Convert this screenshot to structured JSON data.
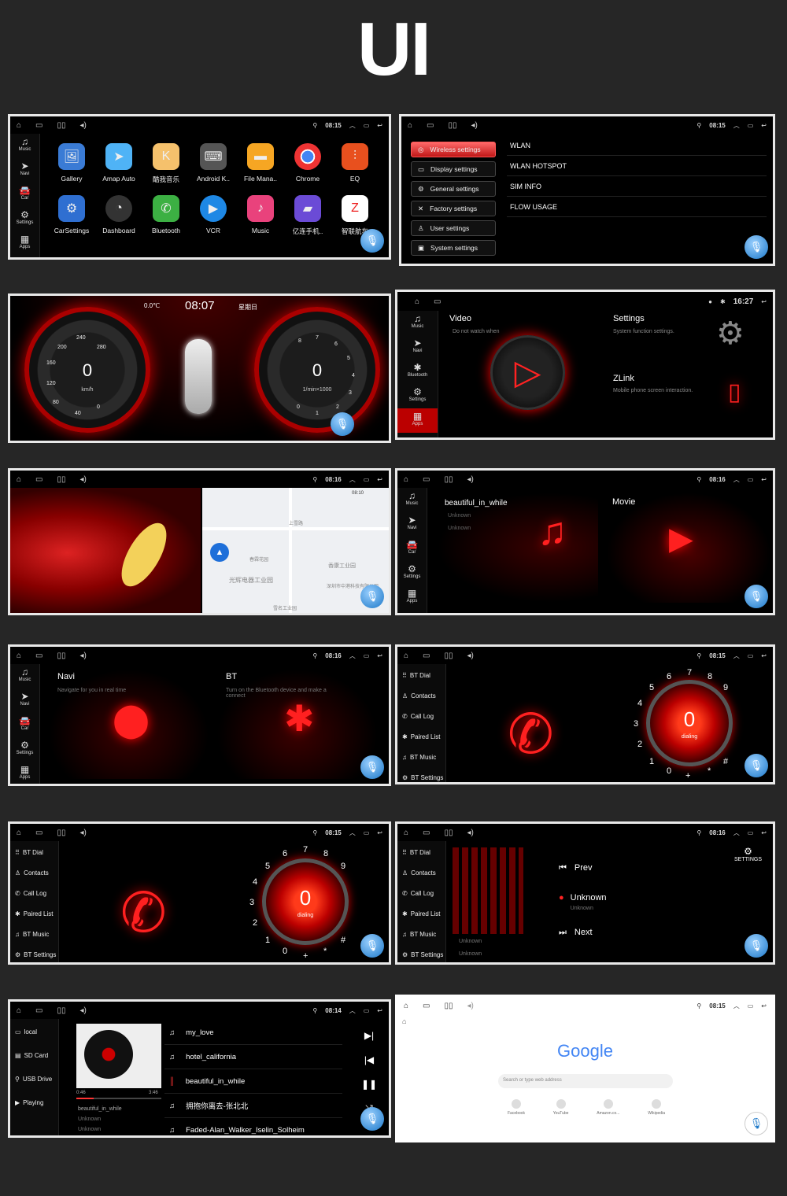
{
  "title": "UI",
  "status": {
    "t1": "08:15",
    "t2": "08:15",
    "t5a": "08:10",
    "t5b": "08:16",
    "t7a": "08:16",
    "t7b": "08:15",
    "t9a": "08:15",
    "t9b": "08:16",
    "t11a": "08:14",
    "t11b": "08:15",
    "t4": "16:27"
  },
  "sidebar": {
    "music": "Music",
    "navi": "Navi",
    "car": "Car",
    "settings": "Settings",
    "apps": "Apps",
    "bluetooth": "Bluetooth"
  },
  "apps": [
    "Gallery",
    "Amap Auto",
    "酷我音乐",
    "Android K..",
    "File Mana..",
    "Chrome",
    "EQ",
    "CarSettings",
    "Dashboard",
    "Bluetooth",
    "VCR",
    "Music",
    "亿连手机..",
    "智联航车"
  ],
  "settings": {
    "items": [
      "Wireless settings",
      "Display settings",
      "General settings",
      "Factory settings",
      "User settings",
      "System settings"
    ],
    "right": [
      "WLAN",
      "WLAN HOTSPOT",
      "SIM INFO",
      "FLOW USAGE"
    ]
  },
  "dash": {
    "temp": "0.0℃",
    "time": "08:07",
    "day": "星期日",
    "speed": "0",
    "speed_unit": "km/h",
    "rpm": "0",
    "rpm_unit": "1/min×1000",
    "speed_ticks": [
      "240",
      "200",
      "280",
      "160",
      "120",
      "80",
      "40",
      "0"
    ],
    "rpm_ticks": [
      "8",
      "7",
      "6",
      "5",
      "4",
      "3",
      "2",
      "1",
      "0"
    ]
  },
  "home4": {
    "video": "Video",
    "video_sub": "Do not watch when",
    "settings": "Settings",
    "settings_sub": "System function settings.",
    "zlink": "ZLink",
    "zlink_sub": "Mobile phone screen interaction.",
    "apps": "Apps"
  },
  "map": {
    "clock": "08:10",
    "places": [
      "光辉电器工业园",
      "春霖花园",
      "上雪路",
      "香康工业园",
      "深圳市中港科技有限公司",
      "雪名工业园"
    ]
  },
  "media": {
    "song": "beautiful_in_while",
    "artist": "Unknown",
    "album": "Unknown",
    "movie": "Movie"
  },
  "navibt": {
    "navi": "Navi",
    "navi_sub": "Navigate for you in real time",
    "bt": "BT",
    "bt_sub": "Turn on the Bluetooth device and make a connect"
  },
  "bt": {
    "menu": [
      "BT Dial",
      "Contacts",
      "Call Log",
      "Paired List",
      "BT Music",
      "BT Settings"
    ],
    "dial_value": "0",
    "dial_status": "dialing",
    "keys": [
      "1",
      "2",
      "3",
      "4",
      "5",
      "6",
      "7",
      "8",
      "9",
      "0",
      "*",
      "#",
      "+"
    ]
  },
  "btmusic": {
    "prev": "Prev",
    "track": "Unknown",
    "track_sub": "Unknown",
    "next": "Next",
    "settings": "SETTINGS",
    "artist": "Unknown",
    "album": "Unknown"
  },
  "player": {
    "sources": [
      "local",
      "SD Card",
      "USB Drive",
      "Playing"
    ],
    "elapsed": "0:46",
    "total": "3:46",
    "song": "beautiful_in_while",
    "artist": "Unknown",
    "album": "Unknown",
    "playlist": [
      "my_love",
      "hotel_california",
      "beautiful_in_while",
      "拥抱你离去-张北北",
      "Faded-Alan_Walker_Iselin_Solheim"
    ]
  },
  "browser": {
    "logo": "Google",
    "search": "Search or type web address",
    "shortcuts": [
      "Facebook",
      "YouTube",
      "Amazon.co...",
      "Wikipedia"
    ]
  }
}
